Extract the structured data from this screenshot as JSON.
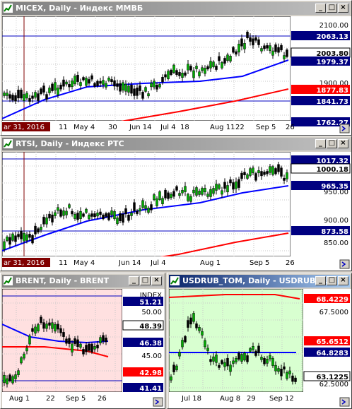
{
  "colors": {
    "bull": "#00aa00",
    "bear": "#000000",
    "ma_blue": "#0000ff",
    "ma_red": "#ff0000",
    "grid": "#c8c8c8",
    "price_bg": "#000080"
  },
  "windows": [
    {
      "title": "MICEX, Daily - Индекс ММВБ",
      "prices": [
        {
          "text": "2100.00",
          "style": "plain"
        },
        {
          "text": "2063.13",
          "style": "blue"
        },
        {
          "text": "2003.80",
          "style": "white"
        },
        {
          "text": "1979.37",
          "style": "blue"
        },
        {
          "text": "1900.00",
          "style": "plain"
        },
        {
          "text": "1877.83",
          "style": "red"
        },
        {
          "text": "1841.73",
          "style": "blue"
        },
        {
          "text": "1762.27",
          "style": "blue"
        }
      ],
      "dates": [
        "ar 31, 2016",
        "11",
        "May 4",
        "30",
        "Jun 14",
        "Jul 4",
        "18",
        "Aug 11",
        "22",
        "Sep 5",
        "26"
      ]
    },
    {
      "title": "RTSI, Daily - Индекс РТС",
      "prices": [
        {
          "text": "1017.32",
          "style": "blue"
        },
        {
          "text": "1000.18",
          "style": "white"
        },
        {
          "text": "965.35",
          "style": "blue"
        },
        {
          "text": "950.00",
          "style": "plain"
        },
        {
          "text": "900.00",
          "style": "plain"
        },
        {
          "text": "873.58",
          "style": "blue"
        },
        {
          "text": "850.00",
          "style": "plain"
        }
      ],
      "dates": [
        "ar 31, 2016",
        "11",
        "May 4",
        "Jun 14",
        "Jul 4",
        "Aug 1",
        "Sep 5",
        "26"
      ]
    },
    {
      "title": "BRENT, Daily - BRENT",
      "prices": [
        {
          "text": "INDEX",
          "style": "plain"
        },
        {
          "text": "51.21",
          "style": "blue"
        },
        {
          "text": "50.00",
          "style": "plain"
        },
        {
          "text": "48.39",
          "style": "white"
        },
        {
          "text": "46.38",
          "style": "blue"
        },
        {
          "text": "45.00",
          "style": "plain"
        },
        {
          "text": "42.98",
          "style": "red"
        },
        {
          "text": "41.41",
          "style": "blue"
        }
      ],
      "dates": [
        "Aug 1",
        "22",
        "Sep 5",
        "26"
      ]
    },
    {
      "title": "USDRUB_TOM, Daily - USDRUB_...",
      "prices": [
        {
          "text": "68.4229",
          "style": "red"
        },
        {
          "text": "67.5000",
          "style": "plain"
        },
        {
          "text": "65.6512",
          "style": "red"
        },
        {
          "text": "64.8283",
          "style": "blue"
        },
        {
          "text": "63.1225",
          "style": "white"
        },
        {
          "text": "62.5000",
          "style": "plain"
        }
      ],
      "dates": [
        "Jul 18",
        "Aug 8",
        "29",
        "Sep 12"
      ]
    }
  ],
  "buttons": {
    "min": "_",
    "max": "□",
    "close": "×"
  },
  "nav_icon": "scroll-to-end-icon"
}
